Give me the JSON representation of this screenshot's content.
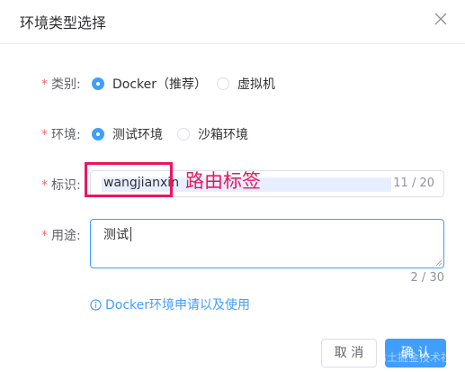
{
  "dialog": {
    "title": "环境类型选择"
  },
  "form": {
    "category": {
      "label": "类别:",
      "options": [
        {
          "label": "Docker（推荐）",
          "checked": true
        },
        {
          "label": "虚拟机",
          "checked": false
        }
      ]
    },
    "environment": {
      "label": "环境:",
      "options": [
        {
          "label": "测试环境",
          "checked": true
        },
        {
          "label": "沙箱环境",
          "checked": false
        }
      ]
    },
    "identifier": {
      "label": "标识:",
      "value": "wangjianxin",
      "count": "11 / 20"
    },
    "purpose": {
      "label": "用途:",
      "value": "测试",
      "count": "2 / 30"
    },
    "required_mark": "*"
  },
  "annotation": {
    "text": "路由标签",
    "color": "#e8175d"
  },
  "help": {
    "text": "Docker环境申请以及使用"
  },
  "buttons": {
    "cancel": "取 消",
    "confirm": "确 认"
  },
  "watermark": {
    "text": "稀土掘金技术社区"
  },
  "colors": {
    "primary": "#409eff",
    "required": "#f56c6c"
  }
}
